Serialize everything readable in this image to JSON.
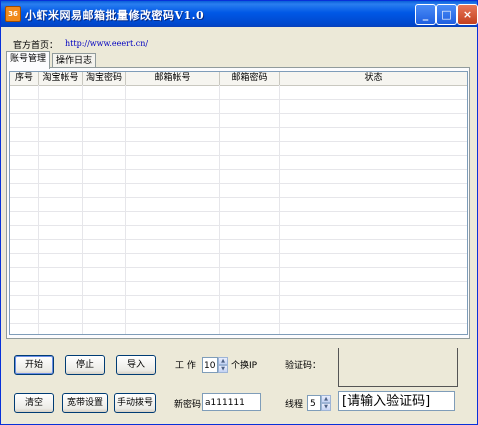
{
  "window": {
    "title": "小虾米网易邮箱批量修改密码V1.0",
    "icon_text": "36"
  },
  "header": {
    "homepage_label": "官方首页：",
    "homepage_url": "http://www.eeert.cn/"
  },
  "tabs": [
    {
      "label": "账号管理",
      "active": true
    },
    {
      "label": "操作日志",
      "active": false
    }
  ],
  "table": {
    "columns": [
      "序号",
      "淘宝帐号",
      "淘宝密码",
      "邮箱帐号",
      "邮箱密码",
      "状态"
    ],
    "rows": []
  },
  "controls": {
    "start_label": "开始",
    "stop_label": "停止",
    "import_label": "导入",
    "clear_label": "清空",
    "broadband_label": "宽带设置",
    "manual_dial_label": "手动拨号",
    "work_label": "工  作",
    "work_value": "10",
    "switch_ip_label": "个换IP",
    "captcha_label": "验证码：",
    "new_password_label": "新密码",
    "new_password_value": "a111111",
    "threads_label": "线程",
    "threads_value": "5",
    "captcha_placeholder": "[请输入验证码]"
  }
}
